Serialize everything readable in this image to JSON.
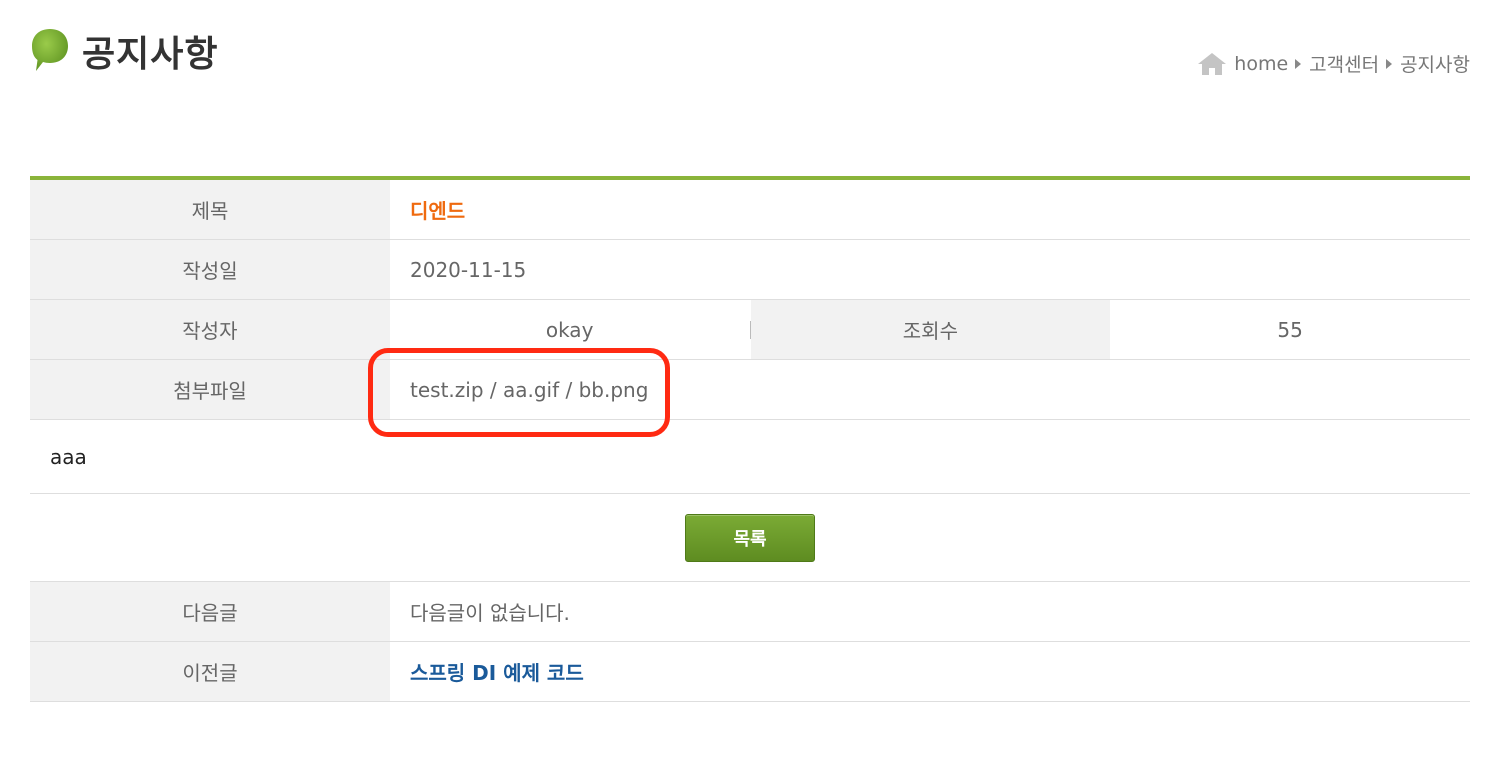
{
  "header": {
    "title": "공지사항",
    "icon": "speech-bubble-icon"
  },
  "breadcrumb": {
    "items": [
      "home",
      "고객센터",
      "공지사항"
    ]
  },
  "post": {
    "title_label": "제목",
    "title_value": "디엔드",
    "date_label": "작성일",
    "date_value": "2020-11-15",
    "author_label": "작성자",
    "author_value": "okay",
    "views_label": "조회수",
    "views_value": "55",
    "attach_label": "첨부파일",
    "attach_value": "test.zip / aa.gif / bb.png",
    "content": "aaa"
  },
  "actions": {
    "list_label": "목록"
  },
  "navigation": {
    "next_label": "다음글",
    "next_value": "다음글이 없습니다.",
    "prev_label": "이전글",
    "prev_value": "스프링 DI 예제 코드"
  },
  "colors": {
    "accent_green": "#8ab43a",
    "title_orange": "#ef6a0f",
    "link_blue": "#1a5a9a",
    "highlight_red": "#ff2a12"
  }
}
